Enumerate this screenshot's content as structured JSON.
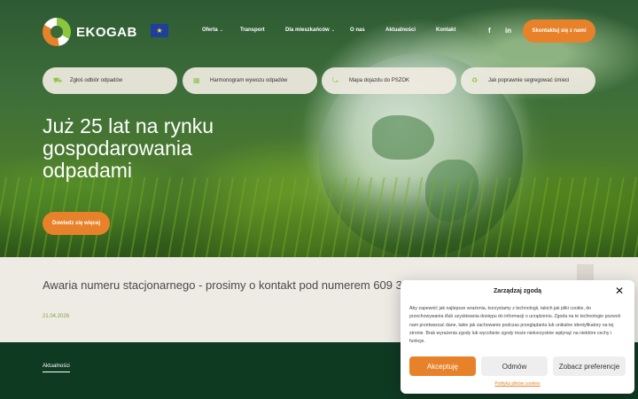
{
  "brand": {
    "name": "EKOGAB",
    "accent": "#e8822a",
    "green": "#8cc63f",
    "dark_green": "#0f3a22"
  },
  "nav": {
    "items": [
      {
        "label": "Oferta",
        "has_dropdown": true
      },
      {
        "label": "Transport",
        "has_dropdown": false
      },
      {
        "label": "Dla mieszkańców",
        "has_dropdown": true
      },
      {
        "label": "O nas",
        "has_dropdown": false
      },
      {
        "label": "Aktualności",
        "has_dropdown": false
      },
      {
        "label": "Kontakt",
        "has_dropdown": false
      }
    ],
    "social": [
      {
        "icon": "facebook-icon",
        "glyph": "f"
      },
      {
        "icon": "linkedin-icon",
        "glyph": "in"
      }
    ],
    "contact_button": "Skontaktuj się z nami"
  },
  "quick_links": [
    {
      "label": "Zgłoś odbiór odpadów",
      "icon": "truck-icon",
      "glyph": "⛟"
    },
    {
      "label": "Harmonogram wywozu odpadów",
      "icon": "calendar-icon",
      "glyph": "▦"
    },
    {
      "label": "Mapa dojazdu do PSZOK",
      "icon": "route-icon",
      "glyph": "⤿"
    },
    {
      "label": "Jak poprawnie segregować śmieci",
      "icon": "recycle-icon",
      "glyph": "♻"
    }
  ],
  "hero": {
    "headline": "Już 25 lat na rynku gospodarowania odpadami",
    "button": "Dowiedz się więcej"
  },
  "news": {
    "title": "Awaria numeru stacjonarnego - prosimy o kontakt pod numerem 609 3",
    "date": "21.04.2026"
  },
  "section": {
    "tab": "Aktualności"
  },
  "cookie": {
    "title": "Zarządzaj zgodą",
    "text": "Aby zapewnić jak najlepsze wrażenia, korzystamy z technologii, takich jak pliki cookie, do przechowywania i/lub uzyskiwania dostępu do informacji o urządzeniu. Zgoda na te technologie pozwoli nam przetwarzać dane, takie jak zachowanie podczas przeglądania lub unikalne identyfikatory na tej stronie. Brak wyrażenia zgody lub wycofanie zgody może niekorzystnie wpłynąć na niektóre cechy i funkcje.",
    "accept": "Akceptuję",
    "deny": "Odmów",
    "preferences": "Zobacz preferencje",
    "policy": "Polityka plików cookies"
  }
}
